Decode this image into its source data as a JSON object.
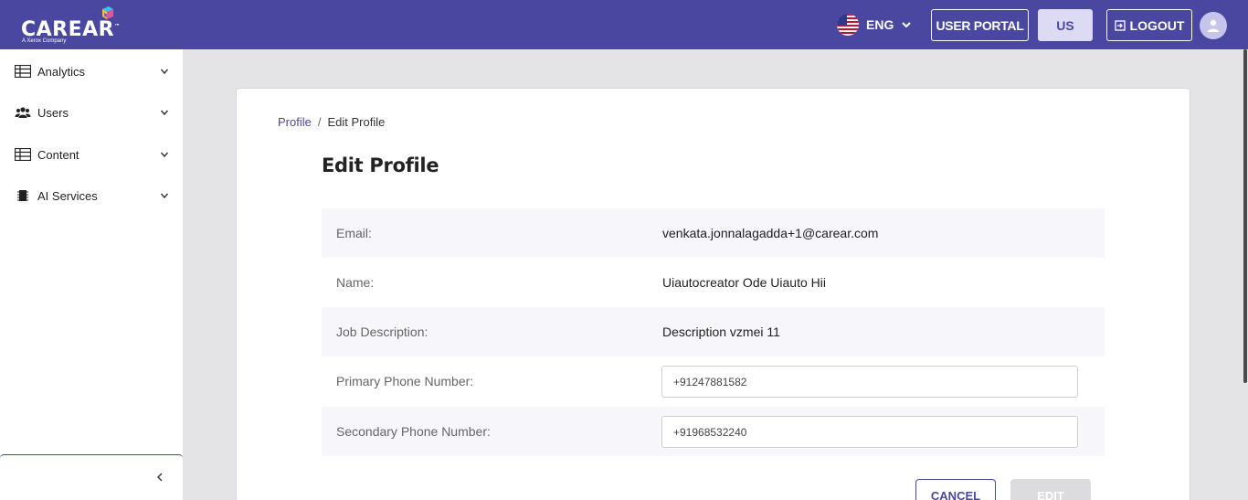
{
  "header": {
    "logo_text": "CAREAR",
    "logo_tm": "™",
    "logo_subtitle": "A Xerox Company",
    "language": "ENG",
    "user_portal_label": "USER PORTAL",
    "region_label": "US",
    "logout_label": "LOGOUT",
    "colors": {
      "bar": "#4a47a0",
      "region_button": "#dcdbf3"
    }
  },
  "sidebar": {
    "items": [
      {
        "label": "Analytics",
        "icon": "table-icon"
      },
      {
        "label": "Users",
        "icon": "users-icon"
      },
      {
        "label": "Content",
        "icon": "table-icon"
      },
      {
        "label": "AI Services",
        "icon": "chip-icon"
      }
    ],
    "collapse_icon": "chevron-left-icon"
  },
  "breadcrumb": {
    "parent": "Profile",
    "separator": "/",
    "current": "Edit Profile"
  },
  "page_title": "Edit Profile",
  "profile": {
    "email_label": "Email:",
    "email_value": "venkata.jonnalagadda+1@carear.com",
    "name_label": "Name:",
    "name_value": "Uiautocreator Ode Uiauto Hii",
    "job_label": "Job Description:",
    "job_value": "Description vzmei 11",
    "primary_phone_label": "Primary Phone Number:",
    "primary_phone_value": "+91247881582",
    "secondary_phone_label": "Secondary Phone Number:",
    "secondary_phone_value": "+91968532240"
  },
  "actions": {
    "cancel_label": "CANCEL",
    "edit_label": "EDIT"
  }
}
